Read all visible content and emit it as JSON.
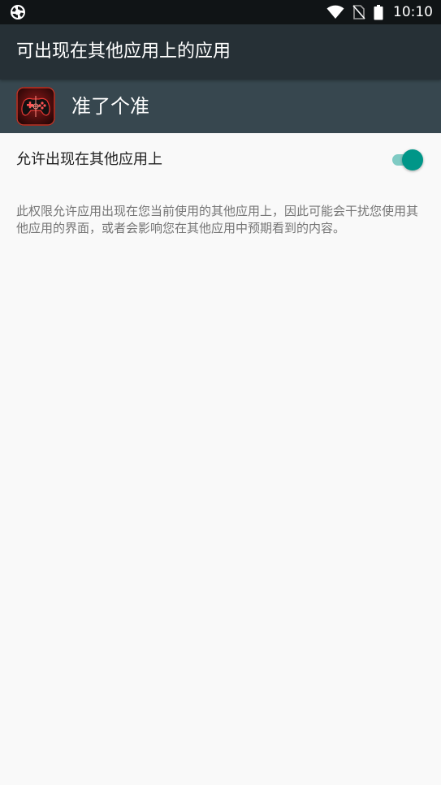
{
  "status_bar": {
    "time": "10:10",
    "icons": [
      "sync-app-icon",
      "wifi-icon",
      "no-sim-icon",
      "battery-icon"
    ]
  },
  "app_bar": {
    "title": "可出现在其他应用上的应用"
  },
  "app_header": {
    "app_name": "准了个准",
    "app_icon": "gamepad-app-icon"
  },
  "setting": {
    "label": "允许出现在其他应用上",
    "enabled": true,
    "description": "此权限允许应用出现在您当前使用的其他应用上，因此可能会干扰您使用其他应用的界面，或者会影响您在其他应用中预期看到的内容。"
  },
  "colors": {
    "status_bar": "#101416",
    "app_bar": "#263036",
    "app_header": "#37474f",
    "background": "#f9f9f9",
    "toggle_thumb": "#009688",
    "toggle_track": "#80cbc4"
  }
}
